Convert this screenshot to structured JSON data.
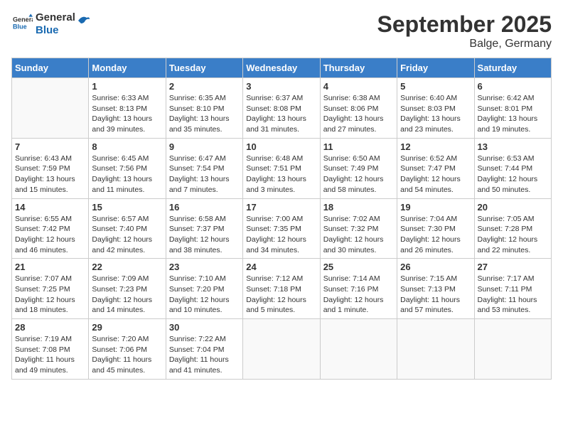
{
  "header": {
    "logo_line1": "General",
    "logo_line2": "Blue",
    "title": "September 2025",
    "subtitle": "Balge, Germany"
  },
  "days_of_week": [
    "Sunday",
    "Monday",
    "Tuesday",
    "Wednesday",
    "Thursday",
    "Friday",
    "Saturday"
  ],
  "weeks": [
    [
      {
        "day": "",
        "info": ""
      },
      {
        "day": "1",
        "info": "Sunrise: 6:33 AM\nSunset: 8:13 PM\nDaylight: 13 hours\nand 39 minutes."
      },
      {
        "day": "2",
        "info": "Sunrise: 6:35 AM\nSunset: 8:10 PM\nDaylight: 13 hours\nand 35 minutes."
      },
      {
        "day": "3",
        "info": "Sunrise: 6:37 AM\nSunset: 8:08 PM\nDaylight: 13 hours\nand 31 minutes."
      },
      {
        "day": "4",
        "info": "Sunrise: 6:38 AM\nSunset: 8:06 PM\nDaylight: 13 hours\nand 27 minutes."
      },
      {
        "day": "5",
        "info": "Sunrise: 6:40 AM\nSunset: 8:03 PM\nDaylight: 13 hours\nand 23 minutes."
      },
      {
        "day": "6",
        "info": "Sunrise: 6:42 AM\nSunset: 8:01 PM\nDaylight: 13 hours\nand 19 minutes."
      }
    ],
    [
      {
        "day": "7",
        "info": "Sunrise: 6:43 AM\nSunset: 7:59 PM\nDaylight: 13 hours\nand 15 minutes."
      },
      {
        "day": "8",
        "info": "Sunrise: 6:45 AM\nSunset: 7:56 PM\nDaylight: 13 hours\nand 11 minutes."
      },
      {
        "day": "9",
        "info": "Sunrise: 6:47 AM\nSunset: 7:54 PM\nDaylight: 13 hours\nand 7 minutes."
      },
      {
        "day": "10",
        "info": "Sunrise: 6:48 AM\nSunset: 7:51 PM\nDaylight: 13 hours\nand 3 minutes."
      },
      {
        "day": "11",
        "info": "Sunrise: 6:50 AM\nSunset: 7:49 PM\nDaylight: 12 hours\nand 58 minutes."
      },
      {
        "day": "12",
        "info": "Sunrise: 6:52 AM\nSunset: 7:47 PM\nDaylight: 12 hours\nand 54 minutes."
      },
      {
        "day": "13",
        "info": "Sunrise: 6:53 AM\nSunset: 7:44 PM\nDaylight: 12 hours\nand 50 minutes."
      }
    ],
    [
      {
        "day": "14",
        "info": "Sunrise: 6:55 AM\nSunset: 7:42 PM\nDaylight: 12 hours\nand 46 minutes."
      },
      {
        "day": "15",
        "info": "Sunrise: 6:57 AM\nSunset: 7:40 PM\nDaylight: 12 hours\nand 42 minutes."
      },
      {
        "day": "16",
        "info": "Sunrise: 6:58 AM\nSunset: 7:37 PM\nDaylight: 12 hours\nand 38 minutes."
      },
      {
        "day": "17",
        "info": "Sunrise: 7:00 AM\nSunset: 7:35 PM\nDaylight: 12 hours\nand 34 minutes."
      },
      {
        "day": "18",
        "info": "Sunrise: 7:02 AM\nSunset: 7:32 PM\nDaylight: 12 hours\nand 30 minutes."
      },
      {
        "day": "19",
        "info": "Sunrise: 7:04 AM\nSunset: 7:30 PM\nDaylight: 12 hours\nand 26 minutes."
      },
      {
        "day": "20",
        "info": "Sunrise: 7:05 AM\nSunset: 7:28 PM\nDaylight: 12 hours\nand 22 minutes."
      }
    ],
    [
      {
        "day": "21",
        "info": "Sunrise: 7:07 AM\nSunset: 7:25 PM\nDaylight: 12 hours\nand 18 minutes."
      },
      {
        "day": "22",
        "info": "Sunrise: 7:09 AM\nSunset: 7:23 PM\nDaylight: 12 hours\nand 14 minutes."
      },
      {
        "day": "23",
        "info": "Sunrise: 7:10 AM\nSunset: 7:20 PM\nDaylight: 12 hours\nand 10 minutes."
      },
      {
        "day": "24",
        "info": "Sunrise: 7:12 AM\nSunset: 7:18 PM\nDaylight: 12 hours\nand 5 minutes."
      },
      {
        "day": "25",
        "info": "Sunrise: 7:14 AM\nSunset: 7:16 PM\nDaylight: 12 hours\nand 1 minute."
      },
      {
        "day": "26",
        "info": "Sunrise: 7:15 AM\nSunset: 7:13 PM\nDaylight: 11 hours\nand 57 minutes."
      },
      {
        "day": "27",
        "info": "Sunrise: 7:17 AM\nSunset: 7:11 PM\nDaylight: 11 hours\nand 53 minutes."
      }
    ],
    [
      {
        "day": "28",
        "info": "Sunrise: 7:19 AM\nSunset: 7:08 PM\nDaylight: 11 hours\nand 49 minutes."
      },
      {
        "day": "29",
        "info": "Sunrise: 7:20 AM\nSunset: 7:06 PM\nDaylight: 11 hours\nand 45 minutes."
      },
      {
        "day": "30",
        "info": "Sunrise: 7:22 AM\nSunset: 7:04 PM\nDaylight: 11 hours\nand 41 minutes."
      },
      {
        "day": "",
        "info": ""
      },
      {
        "day": "",
        "info": ""
      },
      {
        "day": "",
        "info": ""
      },
      {
        "day": "",
        "info": ""
      }
    ]
  ]
}
